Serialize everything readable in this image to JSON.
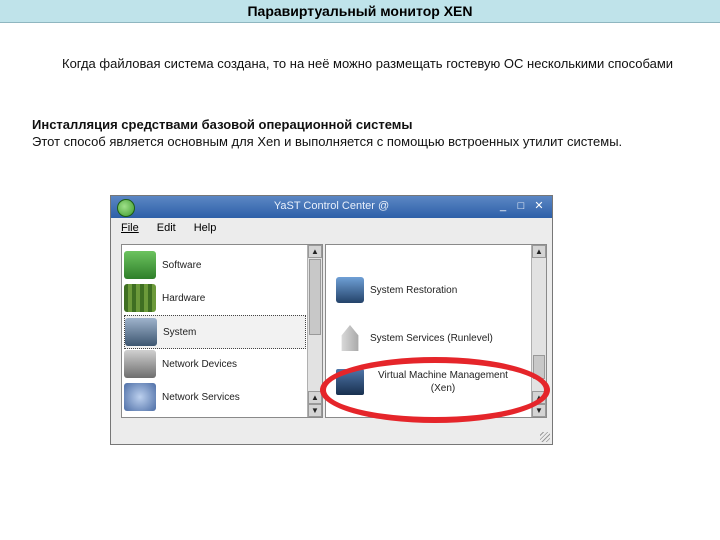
{
  "slide": {
    "title": "Паравиртуальный монитор XEN",
    "intro": "Когда файловая система создана, то на неё можно размещать гостевую ОС несколькими способами",
    "section_heading": "Инсталляция средствами базовой операционной системы",
    "section_text": "Этот способ является основным для Xen и  выполняется с помощью встроенных утилит системы."
  },
  "yast": {
    "window_title": "YaST Control Center @",
    "minimize_glyph": "_",
    "maximize_glyph": "□",
    "close_glyph": "✕",
    "menu": {
      "file": "File",
      "edit": "Edit",
      "help": "Help"
    },
    "categories": [
      {
        "label": "Software",
        "icon": "software-icon",
        "color": "#3d9a3a"
      },
      {
        "label": "Hardware",
        "icon": "hardware-icon",
        "color": "#4c7a2a"
      },
      {
        "label": "System",
        "icon": "system-icon",
        "color": "#506a8a"
      },
      {
        "label": "Network Devices",
        "icon": "network-devices-icon",
        "color": "#7a7a7a"
      },
      {
        "label": "Network Services",
        "icon": "network-services-icon",
        "color": "#5b7ab0"
      }
    ],
    "selected_category": "System",
    "modules": [
      {
        "label": "System Restoration",
        "icon": "system-restoration-icon"
      },
      {
        "label": "System Services (Runlevel)",
        "icon": "rocket-icon"
      },
      {
        "label": "Virtual Machine Management",
        "sublabel": "(Xen)",
        "icon": "vm-monitor-icon"
      }
    ],
    "highlight_color": "#e5252a"
  }
}
